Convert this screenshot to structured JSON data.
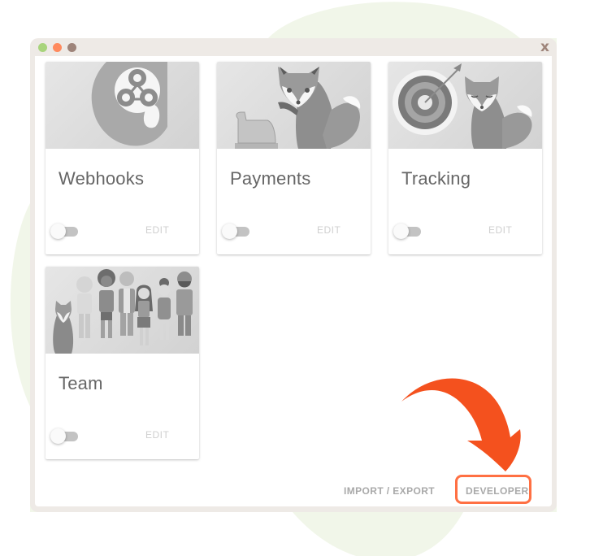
{
  "colors": {
    "accent": "#FF7043",
    "arrow": "#F4511E",
    "window_frame": "#EEEAE6",
    "dot_green": "#A8D47C",
    "dot_orange": "#FF8A5E",
    "dot_brown": "#9E847A",
    "background_blob": "#F1F6E9"
  },
  "window": {
    "close_label": "x"
  },
  "cards": [
    {
      "title": "Webhooks",
      "illustration": "webhook-logo-illustration",
      "toggle_on": false,
      "edit_label": "EDIT"
    },
    {
      "title": "Payments",
      "illustration": "fox-cash-register-illustration",
      "toggle_on": false,
      "edit_label": "EDIT"
    },
    {
      "title": "Tracking",
      "illustration": "fox-target-illustration",
      "toggle_on": false,
      "edit_label": "EDIT"
    },
    {
      "title": "Team",
      "illustration": "team-people-illustration",
      "toggle_on": false,
      "edit_label": "EDIT"
    }
  ],
  "footer": {
    "import_export_label": "IMPORT / EXPORT",
    "developer_label": "DEVELOPER"
  }
}
